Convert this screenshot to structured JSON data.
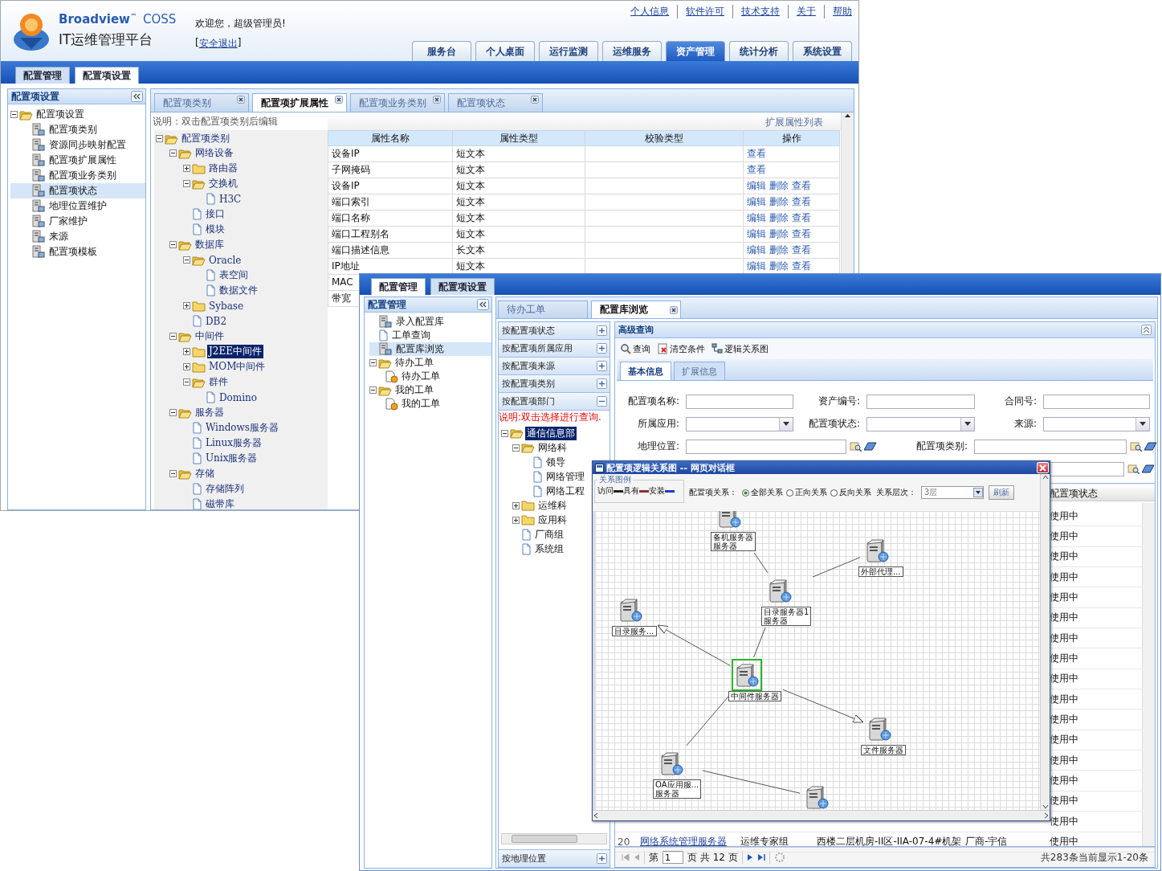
{
  "window_back": {
    "brand": {
      "name": "Broadview$^{™}$",
      "product": "COSS",
      "title": "IT运维管理平台"
    },
    "welcome": "欢迎您，超级管理员!",
    "logout": {
      "prefix": "[",
      "label": "安全退出",
      "suffix": "]"
    },
    "top_links": [
      "个人信息",
      "软件许可",
      "技术支持",
      "关于",
      "帮助"
    ],
    "main_tabs": [
      {
        "label": "服务台",
        "selected": false
      },
      {
        "label": "个人桌面",
        "selected": false
      },
      {
        "label": "运行监测",
        "selected": false
      },
      {
        "label": "运维服务",
        "selected": false
      },
      {
        "label": "资产管理",
        "selected": true
      },
      {
        "label": "统计分析",
        "selected": false
      },
      {
        "label": "系统设置",
        "selected": false
      }
    ],
    "sub_tabs": [
      {
        "label": "配置管理",
        "selected": false
      },
      {
        "label": "配置项设置",
        "selected": true
      }
    ],
    "sidebar": {
      "title": "配置项设置",
      "tree": [
        {
          "label": "配置项设置",
          "kind": "folder",
          "expanded": true,
          "selected": false,
          "children": [
            {
              "label": "配置项类别",
              "kind": "module",
              "selected": false
            },
            {
              "label": "资源同步映射配置",
              "kind": "module",
              "selected": false
            },
            {
              "label": "配置项扩展属性",
              "kind": "module",
              "selected": false
            },
            {
              "label": "配置项业务类别",
              "kind": "module",
              "selected": false
            },
            {
              "label": "配置项状态",
              "kind": "module",
              "selected": true
            },
            {
              "label": "地理位置维护",
              "kind": "module",
              "selected": false
            },
            {
              "label": "厂家维护",
              "kind": "module",
              "selected": false
            },
            {
              "label": "来源",
              "kind": "module",
              "selected": false
            },
            {
              "label": "配置项模板",
              "kind": "module",
              "selected": false
            }
          ]
        }
      ]
    },
    "content_tabs": [
      {
        "label": "配置项类别",
        "selected": false
      },
      {
        "label": "配置项扩展属性",
        "selected": true
      },
      {
        "label": "配置项业务类别",
        "selected": false
      },
      {
        "label": "配置项状态",
        "selected": false
      }
    ],
    "note": "说明：双击配置项类别后编辑",
    "category_tree": [
      {
        "label": "配置项类别",
        "kind": "folder",
        "expanded": true,
        "selected": false,
        "children": [
          {
            "label": "网络设备",
            "kind": "folder",
            "expanded": true,
            "selected": false,
            "children": [
              {
                "label": "路由器",
                "kind": "folder",
                "expanded": false,
                "selected": false
              },
              {
                "label": "交换机",
                "kind": "folder",
                "expanded": true,
                "selected": false,
                "children": [
                  {
                    "label": "H3C",
                    "kind": "leaf",
                    "selected": false
                  }
                ]
              },
              {
                "label": "接口",
                "kind": "leaf",
                "selected": false
              },
              {
                "label": "模块",
                "kind": "leaf",
                "selected": false
              }
            ]
          },
          {
            "label": "数据库",
            "kind": "folder",
            "expanded": true,
            "selected": false,
            "children": [
              {
                "label": "Oracle",
                "kind": "folder",
                "expanded": true,
                "selected": false,
                "children": [
                  {
                    "label": "表空间",
                    "kind": "leaf",
                    "selected": false
                  },
                  {
                    "label": "数据文件",
                    "kind": "leaf",
                    "selected": false
                  }
                ]
              },
              {
                "label": "Sybase",
                "kind": "folder",
                "expanded": false,
                "selected": false
              },
              {
                "label": "DB2",
                "kind": "leaf",
                "selected": false
              }
            ]
          },
          {
            "label": "中间件",
            "kind": "folder",
            "expanded": true,
            "selected": false,
            "children": [
              {
                "label": "J2EE中间件",
                "kind": "folder",
                "expanded": false,
                "selected": true
              },
              {
                "label": "MOM中间件",
                "kind": "folder",
                "expanded": false,
                "selected": false
              },
              {
                "label": "群件",
                "kind": "folder",
                "expanded": true,
                "selected": false,
                "children": [
                  {
                    "label": "Domino",
                    "kind": "leaf",
                    "selected": false
                  }
                ]
              }
            ]
          },
          {
            "label": "服务器",
            "kind": "folder",
            "expanded": true,
            "selected": false,
            "children": [
              {
                "label": "Windows服务器",
                "kind": "leaf",
                "selected": false
              },
              {
                "label": "Linux服务器",
                "kind": "leaf",
                "selected": false
              },
              {
                "label": "Unix服务器",
                "kind": "leaf",
                "selected": false
              }
            ]
          },
          {
            "label": "存储",
            "kind": "folder",
            "expanded": true,
            "selected": false,
            "children": [
              {
                "label": "存储阵列",
                "kind": "leaf",
                "selected": false
              },
              {
                "label": "磁带库",
                "kind": "leaf",
                "selected": false
              }
            ]
          }
        ]
      }
    ],
    "table": {
      "caption": "扩展属性列表",
      "columns": [
        "属性名称",
        "属性类型",
        "校验类型",
        "操作"
      ],
      "rows": [
        {
          "name": "设备IP",
          "type": "短文本",
          "actions": [
            "查看"
          ]
        },
        {
          "name": "子网掩码",
          "type": "短文本",
          "actions": [
            "查看"
          ]
        },
        {
          "name": "设备IP",
          "type": "短文本",
          "actions": [
            "编辑",
            "删除",
            "查看"
          ]
        },
        {
          "name": "端口索引",
          "type": "短文本",
          "actions": [
            "编辑",
            "删除",
            "查看"
          ]
        },
        {
          "name": "端口名称",
          "type": "短文本",
          "actions": [
            "编辑",
            "删除",
            "查看"
          ]
        },
        {
          "name": "端口工程别名",
          "type": "短文本",
          "actions": [
            "编辑",
            "删除",
            "查看"
          ]
        },
        {
          "name": "端口描述信息",
          "type": "长文本",
          "actions": [
            "编辑",
            "删除",
            "查看"
          ]
        },
        {
          "name": "IP地址",
          "type": "短文本",
          "actions": [
            "编辑",
            "删除",
            "查看"
          ]
        },
        {
          "name": "MAC"
        },
        {
          "name": "带宽"
        }
      ]
    }
  },
  "window_front": {
    "sub_tabs": [
      {
        "label": "配置管理",
        "selected": true
      },
      {
        "label": "配置项设置",
        "selected": false
      }
    ],
    "sidebar": {
      "title": "配置管理",
      "tree": [
        {
          "label": "录入配置库",
          "kind": "module",
          "selected": false
        },
        {
          "label": "工单查询",
          "kind": "leaf",
          "selected": false
        },
        {
          "label": "配置库浏览",
          "kind": "module",
          "selected": true
        },
        {
          "label": "待办工单",
          "kind": "folder",
          "expanded": true,
          "selected": false,
          "children": [
            {
              "label": "待办工单",
              "kind": "task",
              "selected": false
            }
          ]
        },
        {
          "label": "我的工单",
          "kind": "folder",
          "expanded": true,
          "selected": false,
          "children": [
            {
              "label": "我的工单",
              "kind": "task",
              "selected": false
            }
          ]
        }
      ]
    },
    "tabs": [
      {
        "label": "待办工单",
        "selected": false,
        "closable": false
      },
      {
        "label": "配置库浏览",
        "selected": true,
        "closable": true
      }
    ],
    "accordion": [
      {
        "label": "按配置项状态",
        "expanded": false
      },
      {
        "label": "按配置项所属应用",
        "expanded": false
      },
      {
        "label": "按配置项来源",
        "expanded": false
      },
      {
        "label": "按配置项类别",
        "expanded": false
      },
      {
        "label": "按配置项部门",
        "expanded": true,
        "note": "说明:双击选择进行查询.",
        "tree": [
          {
            "label": "通信信息部",
            "kind": "folder",
            "expanded": true,
            "selected": true,
            "children": [
              {
                "label": "网络科",
                "kind": "folder",
                "expanded": true,
                "selected": false,
                "children": [
                  {
                    "label": "领导",
                    "kind": "leaf",
                    "selected": false
                  },
                  {
                    "label": "网络管理",
                    "kind": "leaf",
                    "selected": false
                  },
                  {
                    "label": "网络工程",
                    "kind": "leaf",
                    "selected": false
                  }
                ]
              },
              {
                "label": "运维科",
                "kind": "folder",
                "expanded": false,
                "selected": false
              },
              {
                "label": "应用科",
                "kind": "folder",
                "expanded": false,
                "selected": false
              },
              {
                "label": "厂商组",
                "kind": "leaf",
                "selected": false
              },
              {
                "label": "系统组",
                "kind": "leaf",
                "selected": false
              }
            ]
          }
        ]
      },
      {
        "label": "按地理位置",
        "expanded": false
      }
    ],
    "query": {
      "title": "高级查询",
      "tools": [
        {
          "label": "查询",
          "kind": "search"
        },
        {
          "label": "清空条件",
          "kind": "clear"
        },
        {
          "label": "逻辑关系图",
          "kind": "diagram"
        }
      ],
      "tabs": [
        {
          "label": "基本信息",
          "selected": true
        },
        {
          "label": "扩展信息",
          "selected": false
        }
      ],
      "rows": [
        [
          {
            "label": "配置项名称:",
            "kind": "text"
          },
          {
            "label": "资产编号:",
            "kind": "text"
          },
          {
            "label": "合同号:",
            "kind": "text"
          }
        ],
        [
          {
            "label": "所属应用:",
            "kind": "select"
          },
          {
            "label": "配置项状态:",
            "kind": "select"
          },
          {
            "label": "来源:",
            "kind": "select"
          }
        ],
        [
          {
            "label": "地理位置:",
            "kind": "picker"
          },
          {
            "label": "配置项类别:",
            "kind": "picker"
          }
        ],
        [
          {
            "kind": "hidden"
          },
          {
            "kind": "picker"
          }
        ]
      ]
    },
    "grid": {
      "status_header": "配置项状态",
      "rows": [
        {
          "status": "使用中"
        },
        {
          "status": "使用中"
        },
        {
          "status": "使用中"
        },
        {
          "status": "使用中"
        },
        {
          "status": "使用中"
        },
        {
          "status": "使用中"
        },
        {
          "status": "使用中"
        },
        {
          "status": "使用中"
        },
        {
          "status": "使用中"
        },
        {
          "status": "使用中"
        },
        {
          "status": "使用中"
        },
        {
          "status": "使用中"
        },
        {
          "status": "使用中"
        },
        {
          "status": "使用中"
        },
        {
          "status": "使用中"
        },
        {
          "status": "使用中"
        },
        {
          "number": "20",
          "name": "网络系统管理服务器",
          "group": "运维专家组",
          "location": "西楼二层机房-II区-IIA-07-4#机架",
          "vendor": "厂商-宇信",
          "status": "使用中"
        }
      ]
    },
    "pager": {
      "before": "第",
      "page": "1",
      "after": "页 共 12 页",
      "summary": "共283条当前显示1-20条"
    }
  },
  "dialog": {
    "title": "配置项逻辑关系图 -- 网页对话框",
    "legend": {
      "title": "关系图例",
      "items": [
        {
          "label": "访问",
          "color": "#222222"
        },
        {
          "label": "具有",
          "color": "#8b3030"
        },
        {
          "label": "安装",
          "color": "#1a3fc0"
        }
      ]
    },
    "relation": {
      "label": "配置项关系：",
      "options": [
        {
          "label": "全部关系",
          "selected": true
        },
        {
          "label": "正向关系",
          "selected": false
        },
        {
          "label": "反向关系",
          "selected": false
        }
      ]
    },
    "depth": {
      "label": "关系层次：",
      "value": "3层"
    },
    "refresh": "刷新",
    "graph": {
      "nodes": [
        {
          "lines": [
            "备机服务器",
            "服务器"
          ],
          "selected": false
        },
        {
          "lines": [
            "外部代理..."
          ],
          "selected": false
        },
        {
          "lines": [
            "目录服务器1",
            "服务器"
          ],
          "selected": false
        },
        {
          "lines": [
            "目录服务..."
          ],
          "selected": false
        },
        {
          "lines": [
            "中间件服务器"
          ],
          "selected": true
        },
        {
          "lines": [
            "文件服务器"
          ],
          "selected": false
        },
        {
          "lines": [
            "OA应用服...",
            "服务器"
          ],
          "selected": false
        },
        {
          "selected": false
        }
      ],
      "edges": [
        {
          "directed": false
        },
        {
          "directed": false
        },
        {
          "directed": false
        },
        {
          "directed": true
        },
        {
          "directed": true
        },
        {
          "directed": false
        },
        {
          "directed": false
        }
      ]
    }
  }
}
